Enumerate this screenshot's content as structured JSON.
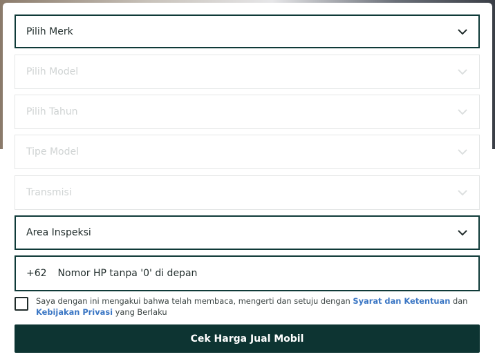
{
  "form": {
    "brand": {
      "placeholder": "Pilih Merk",
      "icon": "chevron-down-icon"
    },
    "model": {
      "placeholder": "Pilih Model",
      "icon": "chevron-down-icon"
    },
    "year": {
      "placeholder": "Pilih Tahun",
      "icon": "chevron-down-icon"
    },
    "type": {
      "placeholder": "Tipe Model",
      "icon": "chevron-down-icon"
    },
    "transmission": {
      "placeholder": "Transmisi",
      "icon": "chevron-down-icon"
    },
    "area": {
      "placeholder": "Area Inspeksi",
      "icon": "chevron-down-icon"
    },
    "phone": {
      "prefix": "+62",
      "placeholder": "Nomor HP tanpa '0' di depan"
    }
  },
  "consent": {
    "text_before": "Saya dengan ini mengakui bahwa telah membaca, mengerti dan setuju dengan ",
    "terms_link": "Syarat dan Ketentuan",
    "text_middle": " dan ",
    "privacy_link": "Kebijakan Privasi",
    "text_after": " yang Berlaku"
  },
  "submit_label": "Cek Harga Jual Mobil",
  "colors": {
    "primary": "#0d3432",
    "link": "#3a76c4",
    "disabled_text": "#cfd3d3"
  }
}
